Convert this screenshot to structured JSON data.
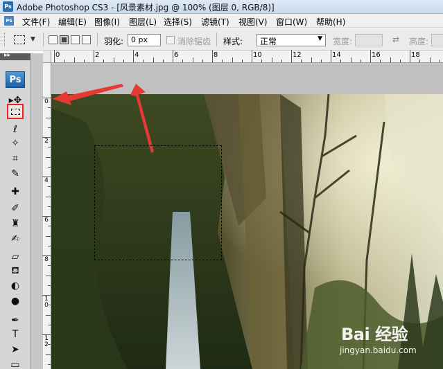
{
  "window": {
    "title": "Adobe Photoshop CS3 - [风景素材.jpg @ 100% (图层 0, RGB/8)]",
    "icon_text": "Ps"
  },
  "menubar": {
    "icon_text": "Ps",
    "items": [
      {
        "label": "文件(F)"
      },
      {
        "label": "编辑(E)"
      },
      {
        "label": "图像(I)"
      },
      {
        "label": "图层(L)"
      },
      {
        "label": "选择(S)"
      },
      {
        "label": "滤镜(T)"
      },
      {
        "label": "视图(V)"
      },
      {
        "label": "窗口(W)"
      },
      {
        "label": "帮助(H)"
      }
    ]
  },
  "options_bar": {
    "feather_label": "羽化:",
    "feather_value": "0 px",
    "antialias_label": "消除锯齿",
    "style_label": "样式:",
    "style_value": "正常",
    "width_label": "宽度:",
    "height_label": "高度:"
  },
  "toolbox": {
    "logo": "Ps",
    "tools": [
      {
        "name": "move-tool",
        "glyph": "▸✥"
      },
      {
        "name": "rectangular-marquee-tool",
        "glyph": ""
      },
      {
        "name": "lasso-tool",
        "glyph": "ℓ"
      },
      {
        "name": "magic-wand-tool",
        "glyph": "✧"
      },
      {
        "name": "crop-tool",
        "glyph": "⌗"
      },
      {
        "name": "slice-tool",
        "glyph": "✎"
      },
      {
        "name": "healing-brush-tool",
        "glyph": "✚"
      },
      {
        "name": "brush-tool",
        "glyph": "✐"
      },
      {
        "name": "clone-stamp-tool",
        "glyph": "♜"
      },
      {
        "name": "history-brush-tool",
        "glyph": "✍"
      },
      {
        "name": "eraser-tool",
        "glyph": "▱"
      },
      {
        "name": "paint-bucket-tool",
        "glyph": "⛾"
      },
      {
        "name": "blur-tool",
        "glyph": "◐"
      },
      {
        "name": "dodge-tool",
        "glyph": "●"
      },
      {
        "name": "pen-tool",
        "glyph": "✒"
      },
      {
        "name": "type-tool",
        "glyph": "T"
      },
      {
        "name": "path-selection-tool",
        "glyph": "➤"
      },
      {
        "name": "rectangle-tool",
        "glyph": "▭"
      }
    ]
  },
  "rulers": {
    "horizontal": [
      "0",
      "2",
      "4",
      "6",
      "8",
      "10",
      "12",
      "14",
      "16",
      "18"
    ],
    "vertical": [
      "0",
      "2",
      "4",
      "6",
      "8",
      "10",
      "12"
    ]
  },
  "watermark": {
    "logo": "Bai 经验",
    "url": "jingyan.baidu.com"
  },
  "colors": {
    "annotation_red": "#e53935",
    "highlight_box": "#e22222",
    "toolbox_bg": "#d6d6d6"
  }
}
